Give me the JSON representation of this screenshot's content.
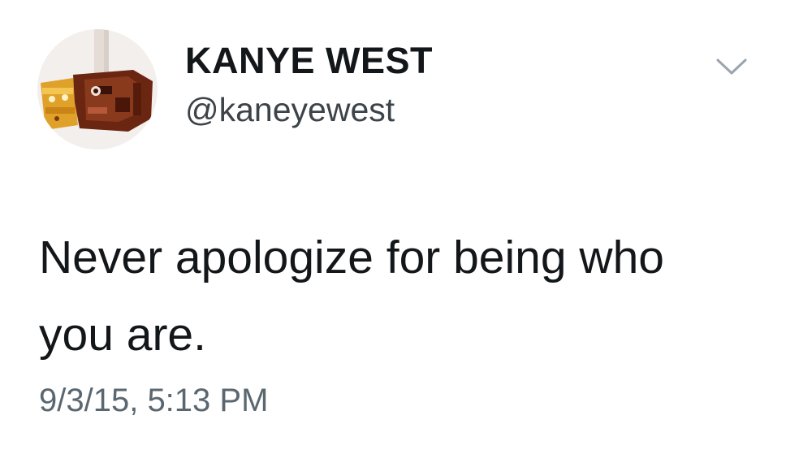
{
  "tweet": {
    "author": {
      "display_name": "KANYE WEST",
      "handle": "@kaneyewest",
      "avatar_icon": "profile-photo"
    },
    "menu_icon": "chevron-down-icon",
    "text": "Never apologize for being who you are.",
    "timestamp": "9/3/15, 5:13 PM"
  },
  "colors": {
    "text": "#14171a",
    "secondary_text": "#5b6770",
    "chevron": "#9aa4ad",
    "background": "#ffffff"
  }
}
